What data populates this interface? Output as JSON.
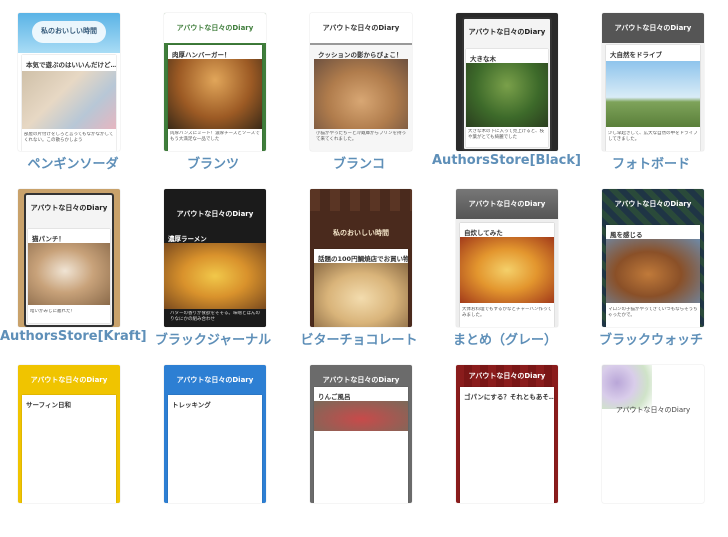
{
  "themes": [
    {
      "label": "ペンギンソーダ",
      "header_text": "私のおいしい時間",
      "post_title": "本気で遊ぶのはいいんだけど…",
      "snippet": "部屋の片付けをしろと言ってもなかなかしてくれない。この散らかしよう"
    },
    {
      "label": "ブランツ",
      "header_text": "アバウトな日々のDiary",
      "post_title": "肉厚ハンバーガー！",
      "snippet": "肉厚バンズにミート！濃厚チーズとソースでもう大満足な一品でした"
    },
    {
      "label": "ブランコ",
      "header_text": "アバウトな日々のDiary",
      "post_title": "クッションの影からぴょこ！",
      "snippet": "小猫がやったちーと冷蔵庫からプリンを持って来てくれました。"
    },
    {
      "label": "AuthorsStore[Black]",
      "header_text": "アバウトな日々のDiary",
      "post_title": "大きな木",
      "snippet": "大きな木の下に入って見上げると、枝や葉がとても綺麗でした"
    },
    {
      "label": "フォトボード",
      "header_text": "アバウトな日々のDiary",
      "post_title": "大自然をドライブ",
      "snippet": "少し早起きして、広大な自然の中をドライブしてきました。"
    },
    {
      "label": "AuthorsStore[Kraft]",
      "header_text": "アバウトな日々のDiary",
      "post_title": "猫パンチ！",
      "snippet": "暗いかみじに叢れた！"
    },
    {
      "label": "ブラックジャーナル",
      "header_text": "アバウトな日々のDiary",
      "post_title": "濃厚ラーメン",
      "snippet": "バターの香りが食欲をそそる。味噌とほんのりなにかの組み合わせ"
    },
    {
      "label": "ビターチョコレート",
      "header_text": "私のおいしい時間",
      "post_title": "話題の100円鯛焼店でお買い物",
      "snippet": ""
    },
    {
      "label": "まとめ（グレー）",
      "header_text": "アバウトな日々のDiary",
      "post_title": "自炊してみた",
      "snippet": "大体お料理でもするかなとチャーハン作ってみました。"
    },
    {
      "label": "ブラックウォッチ",
      "header_text": "アバウトな日々のDiary",
      "post_title": "風を感じる",
      "snippet": "マロンの子猫がやってきていつもならそうちゃったかで。"
    },
    {
      "label": "",
      "header_text": "アバウトな日々のDiary",
      "post_title": "サーフィン日和",
      "snippet": ""
    },
    {
      "label": "",
      "header_text": "アバウトな日々のDiary",
      "post_title": "トレッキング",
      "snippet": ""
    },
    {
      "label": "",
      "header_text": "アバウトな日々のDiary",
      "post_title": "りんご風呂",
      "snippet": ""
    },
    {
      "label": "",
      "header_text": "アバウトな日々のDiary",
      "post_title": "ゴパンにする？それともあそ…",
      "snippet": ""
    },
    {
      "label": "",
      "header_text": "アバウトな日々のDiary",
      "post_title": "",
      "snippet": ""
    }
  ],
  "colors": {
    "label": "#5e8fb8",
    "penguin_sky": "#7fc8f0",
    "plants_green": "#3f7d3b",
    "kraft": "#c9a26b",
    "black": "#1b1b1b",
    "choco": "#4a2a1d",
    "gray": "#6b6b6b",
    "watch_navy": "#1f3545",
    "yellow": "#f0c400",
    "blue": "#2d7fd3",
    "red": "#8a1c1c"
  }
}
